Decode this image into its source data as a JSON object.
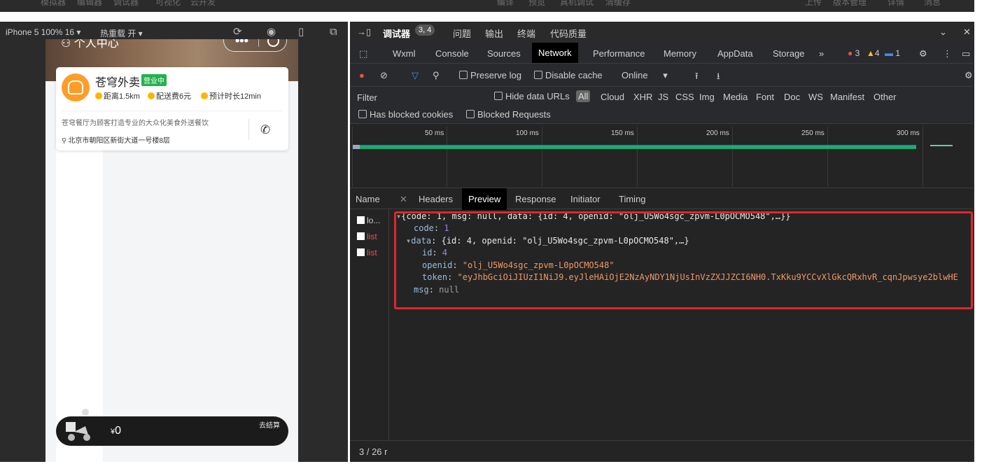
{
  "top_menu": [
    "模拟器",
    "编辑器",
    "调试器",
    "可视化",
    "云开发",
    "编译",
    "预览",
    "真机调试",
    "清缓存",
    "上传",
    "版本管理",
    "详情",
    "消息"
  ],
  "simulator": {
    "device_label": "iPhone 5 100% 16 ▾",
    "hot_reload_label": "热重载 开 ▾",
    "page_header_title": "个人中心",
    "shop": {
      "name": "苍穹外卖",
      "status_badge": "营业中",
      "distance": "距离1.5km",
      "delivery_fee": "配送费6元",
      "estimated_time": "预计时长12min",
      "description": "苍穹餐厅为顾客打造专业的大众化美食外送餐饮",
      "address": "北京市朝阳区新街大道一号楼8层"
    },
    "cart": {
      "currency": "¥",
      "amount": "0",
      "checkout_label": "去结算"
    }
  },
  "devtools": {
    "top_tabs": {
      "debugger_label": "调试器",
      "debugger_badge": "3, 4",
      "issues_label": "问题",
      "output_label": "输出",
      "terminal_label": "终端",
      "code_quality_label": "代码质量"
    },
    "panel_tabs": [
      "Wxml",
      "Console",
      "Sources",
      "Network",
      "Performance",
      "Memory",
      "AppData",
      "Storage"
    ],
    "active_panel": "Network",
    "more_tabs": "»",
    "counts": {
      "errors": "3",
      "warnings": "4",
      "info": "1"
    },
    "controls": {
      "preserve_log": "Preserve log",
      "disable_cache": "Disable cache",
      "throttle": "Online"
    },
    "filter": {
      "placeholder": "Filter",
      "hide_data_urls": "Hide data URLs",
      "types": [
        "All",
        "Cloud",
        "XHR",
        "JS",
        "CSS",
        "Img",
        "Media",
        "Font",
        "Doc",
        "WS",
        "Manifest",
        "Other"
      ],
      "has_blocked_cookies": "Has blocked cookies",
      "blocked_requests": "Blocked Requests"
    },
    "timeline_ticks": [
      "50 ms",
      "100 ms",
      "150 ms",
      "200 ms",
      "250 ms",
      "300 ms"
    ],
    "detail_tabs": [
      "Headers",
      "Preview",
      "Response",
      "Initiator",
      "Timing"
    ],
    "active_detail_tab": "Preview",
    "name_header": "Name",
    "requests": [
      {
        "name": "lo...",
        "color": "#cfcfcf"
      },
      {
        "name": "list",
        "color": "#e8524a"
      },
      {
        "name": "list",
        "color": "#e8524a"
      }
    ],
    "status": "3 / 26 r",
    "preview": {
      "summary": "{code: 1, msg: null, data: {id: 4, openid: \"olj_U5Wo4sgc_zpvm-L0pOCMO548\",…}}",
      "code_key": "code",
      "code_value": "1",
      "data_key": "data",
      "data_summary": "{id: 4, openid: \"olj_U5Wo4sgc_zpvm-L0pOCMO548\",…}",
      "id_key": "id",
      "id_value": "4",
      "openid_key": "openid",
      "openid_value": "\"olj_U5Wo4sgc_zpvm-L0pOCMO548\"",
      "token_key": "token",
      "token_value": "\"eyJhbGciOiJIUzI1NiJ9.eyJleHAiOjE2NzAyNDY1NjUsInVzZXJJZCI6NH0.TxKku9YCCvXlGkcQRxhvR_cqnJpwsye2blwHE",
      "msg_key": "msg",
      "msg_value": "null"
    }
  },
  "colors": {
    "highlight_border": "#e0262b",
    "open_badge": "#22b24c",
    "brand_orange": "#ff9d28",
    "active_tab_bg": "#000000"
  }
}
